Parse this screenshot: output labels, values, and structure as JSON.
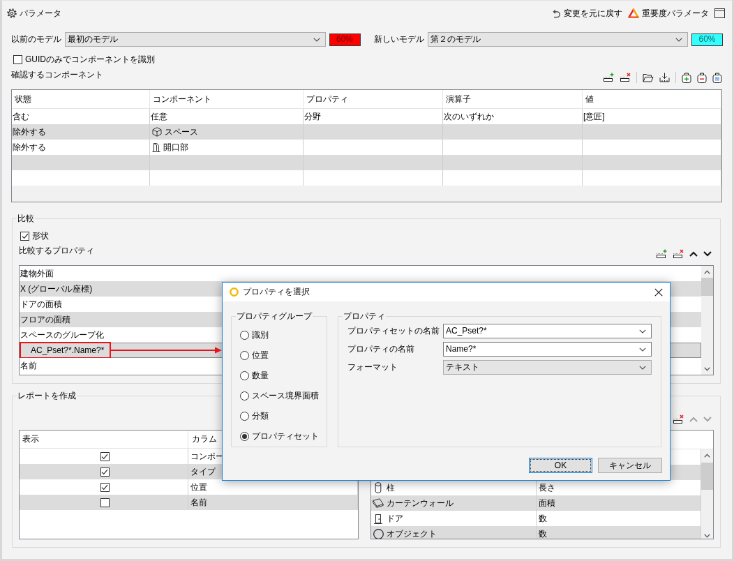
{
  "header": {
    "title": "パラメータ",
    "actions": [
      {
        "kind": "undo",
        "label": "変更を元に戻す"
      },
      {
        "kind": "severity",
        "label": "重要度パラメータ"
      }
    ]
  },
  "models": [
    {
      "label": "以前のモデル",
      "value": "最初のモデル",
      "match": "60%",
      "color": "#ff0000"
    },
    {
      "label": "新しいモデル",
      "value": "第２のモデル",
      "match": "60%",
      "color": "#33ffff"
    }
  ],
  "guid_only": {
    "label": "GUIDのみでコンポーネントを識別",
    "checked": false
  },
  "components": {
    "title": "確認するコンポーネント",
    "toolbar": [
      [
        {
          "kind": "add_row"
        },
        {
          "kind": "remove_row"
        }
      ],
      [
        {
          "kind": "open"
        },
        {
          "kind": "save"
        }
      ],
      [
        {
          "kind": "add_rule"
        },
        {
          "kind": "remove_rule"
        },
        {
          "kind": "equal_rule"
        }
      ]
    ],
    "columns": [
      "状態",
      "コンポーネント",
      "プロパティ",
      "演算子",
      "値"
    ],
    "rows": [
      {
        "kind": "any",
        "status": "含む",
        "component": "任意",
        "property": "分野",
        "operator": "次のいずれか",
        "value": "[意匠]"
      },
      {
        "kind": "space",
        "status": "除外する",
        "component": "スペース"
      },
      {
        "kind": "opening",
        "status": "除外する",
        "component": "開口部"
      }
    ]
  },
  "compare": {
    "title": "比較",
    "shape": {
      "label": "形状",
      "checked": true
    },
    "properties_title": "比較するプロパティ",
    "toolbar": [
      {
        "kind": "add_row",
        "disabled": false
      },
      {
        "kind": "remove_row",
        "disabled": false
      },
      {
        "kind": "up",
        "disabled": false
      },
      {
        "kind": "down",
        "disabled": false
      }
    ],
    "properties": [
      {
        "label": "建物外面",
        "selected": false,
        "callout": false
      },
      {
        "label": "X (グローバル座標)",
        "selected": false,
        "callout": false
      },
      {
        "label": "ドアの面積",
        "selected": false,
        "callout": false
      },
      {
        "label": "フロアの面積",
        "selected": false,
        "callout": false
      },
      {
        "label": "スペースのグループ化",
        "selected": false,
        "callout": false
      },
      {
        "label": "AC_Pset?*.Name?*",
        "selected": true,
        "callout": true
      },
      {
        "label": "名前",
        "selected": false,
        "callout": false
      }
    ]
  },
  "report": {
    "title": "レポートを作成",
    "toolbar": [
      {
        "kind": "remove_row",
        "disabled": false
      },
      {
        "kind": "up",
        "disabled": true
      },
      {
        "kind": "down",
        "disabled": true
      }
    ],
    "columns": [
      "表示",
      "カラム"
    ],
    "rows": [
      {
        "checked": true,
        "column": "コンポー"
      },
      {
        "checked": true,
        "column": "タイプ"
      },
      {
        "checked": true,
        "column": "位置"
      },
      {
        "checked": false,
        "column": "名前"
      }
    ],
    "quantities": [
      {
        "kind": "column",
        "component": "柱",
        "measure": "長さ"
      },
      {
        "kind": "curtain_wall",
        "component": "カーテンウォール",
        "measure": "面積"
      },
      {
        "kind": "door",
        "component": "ドア",
        "measure": "数"
      },
      {
        "kind": "object",
        "component": "オブジェクト",
        "measure": "数"
      }
    ]
  },
  "dialog": {
    "title": "プロパティを選択",
    "group": {
      "title": "プロパティグループ",
      "options": [
        {
          "label": "識別",
          "selected": false
        },
        {
          "label": "位置",
          "selected": false
        },
        {
          "label": "数量",
          "selected": false
        },
        {
          "label": "スペース境界面積",
          "selected": false
        },
        {
          "label": "分類",
          "selected": false
        },
        {
          "label": "プロパティセット",
          "selected": true
        }
      ]
    },
    "property": {
      "title": "プロパティ",
      "fields": [
        {
          "kind": "editable",
          "label": "プロパティセットの名前",
          "value": "AC_Pset?*"
        },
        {
          "kind": "editable",
          "label": "プロパティの名前",
          "value": "Name?*"
        },
        {
          "kind": "list",
          "label": "フォーマット",
          "value": "テキスト"
        }
      ]
    },
    "buttons": [
      {
        "label": "OK",
        "default": true
      },
      {
        "label": "キャンセル",
        "default": false
      }
    ]
  }
}
